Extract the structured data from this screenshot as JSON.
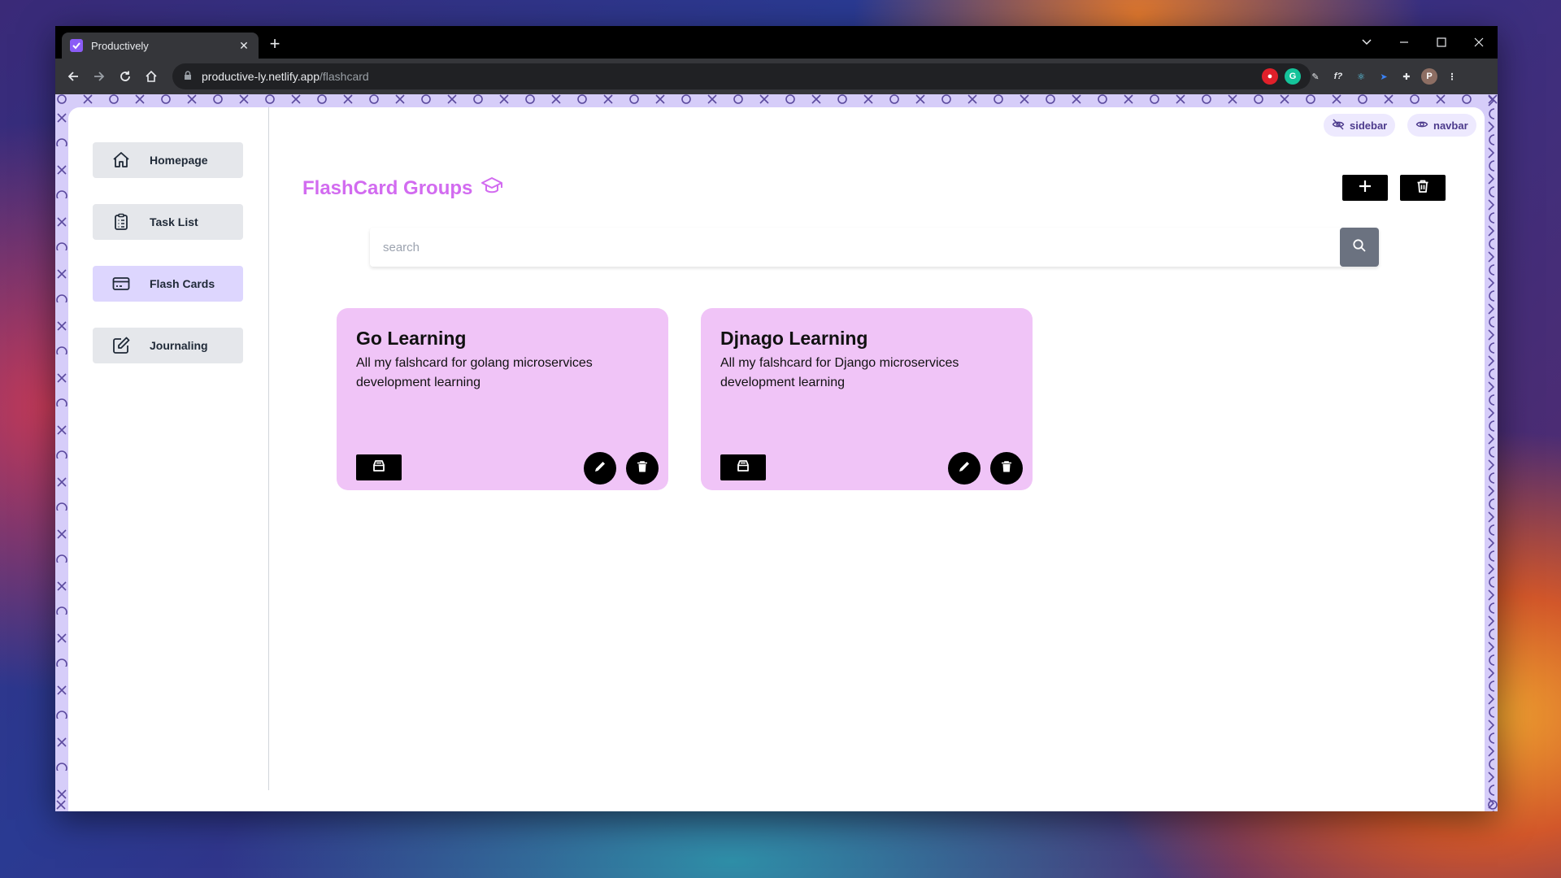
{
  "browser": {
    "tab_title": "Productively",
    "url_host": "productive-ly.netlify.app",
    "url_path": "/flashcard",
    "profile_initial": "P"
  },
  "sidebar": {
    "items": [
      {
        "label": "Homepage",
        "icon": "home-icon"
      },
      {
        "label": "Task List",
        "icon": "clipboard-icon"
      },
      {
        "label": "Flash Cards",
        "icon": "card-icon",
        "active": true
      },
      {
        "label": "Journaling",
        "icon": "edit-icon"
      }
    ]
  },
  "toggles": {
    "sidebar_label": "sidebar",
    "navbar_label": "navbar"
  },
  "main": {
    "heading": "FlashCard Groups",
    "search_placeholder": "search"
  },
  "cards": [
    {
      "title": "Go Learning",
      "description": "All my falshcard for golang microservices development learning"
    },
    {
      "title": "Djnago Learning",
      "description": "All my falshcard for Django microservices development learning"
    }
  ],
  "colors": {
    "accent": "#d26bf0",
    "card_bg": "#f0c4f7",
    "active_nav": "#ddd6fe",
    "frame_bg": "#d6cdf9",
    "pattern": "#5b4a9e"
  }
}
